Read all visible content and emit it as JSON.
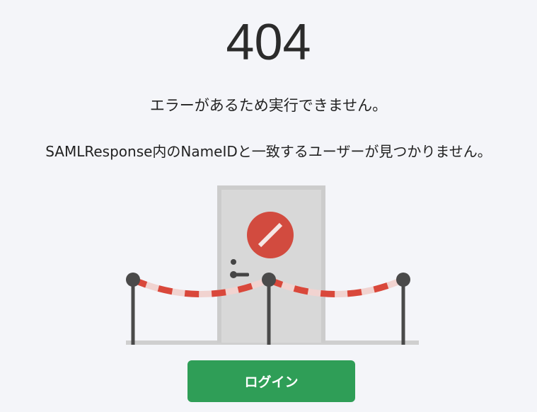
{
  "error": {
    "code": "404",
    "message": "エラーがあるため実行できません。",
    "detail": "SAMLResponse内のNameIDと一致するユーザーが見つかりません。"
  },
  "actions": {
    "login_label": "ログイン"
  },
  "colors": {
    "background": "#f4f5f9",
    "button": "#2f9e57",
    "stop_sign": "#d24b3f",
    "door": "#d6d6d6",
    "rope_red": "#d9483b",
    "rope_light": "#f1d3d0"
  },
  "illustration": {
    "icons": [
      "door-icon",
      "stop-sign-icon",
      "stanchion-icon",
      "barrier-rope-icon"
    ]
  }
}
